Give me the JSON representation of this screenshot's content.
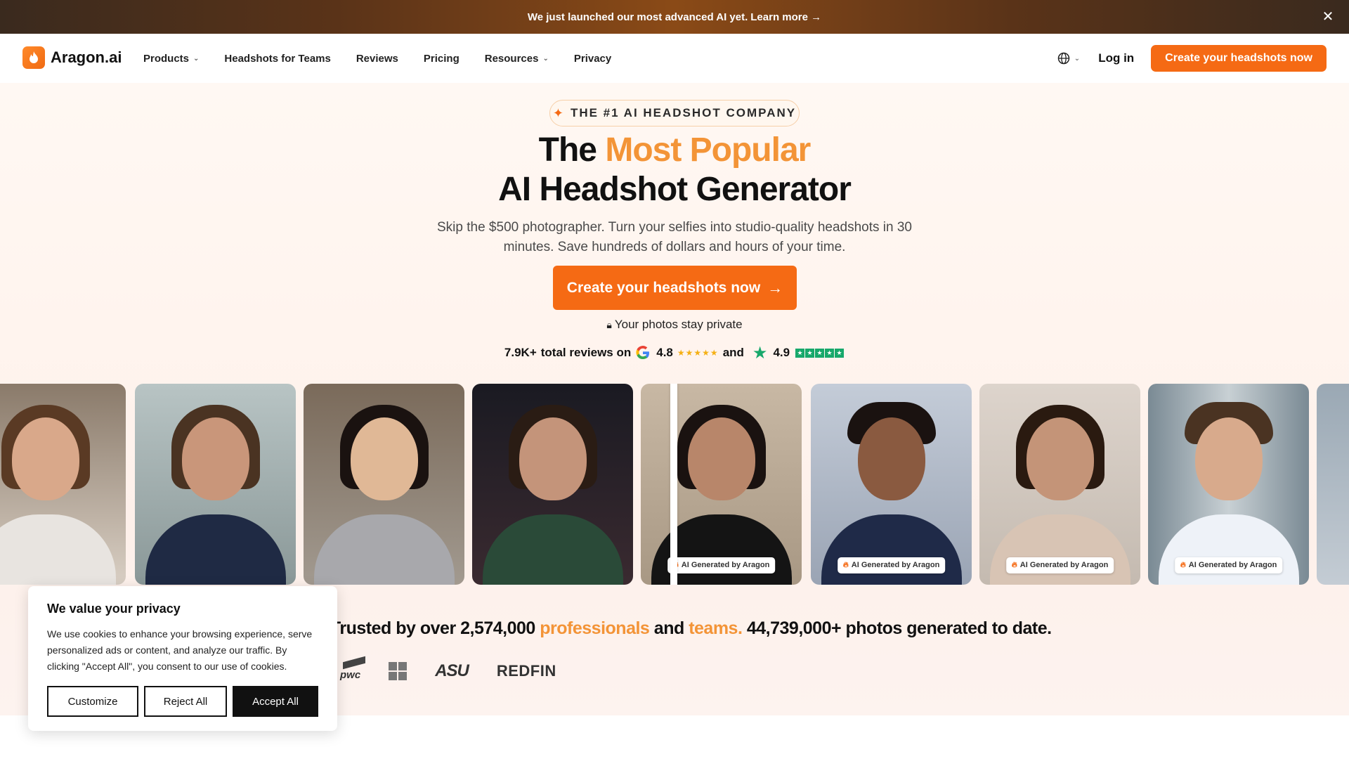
{
  "announcement": {
    "text": "We just launched our most advanced AI yet.",
    "link": "Learn more →"
  },
  "brand": {
    "name": "Aragon.ai",
    "accent_color": "#f56a14"
  },
  "nav": {
    "items": [
      {
        "label": "Products",
        "dropdown": true
      },
      {
        "label": "Headshots for Teams",
        "dropdown": false
      },
      {
        "label": "Reviews",
        "dropdown": false
      },
      {
        "label": "Pricing",
        "dropdown": false
      },
      {
        "label": "Resources",
        "dropdown": true
      },
      {
        "label": "Privacy",
        "dropdown": false
      }
    ],
    "login": "Log in",
    "cta": "Create your headshots now"
  },
  "hero": {
    "badge": "THE #1 AI HEADSHOT COMPANY",
    "title_part1": "The ",
    "title_accent": "Most Popular",
    "title_line2": "AI Headshot Generator",
    "subtitle": "Skip the $500 photographer. Turn your selfies into studio-quality headshots in 30 minutes. Save hundreds of dollars and hours of your time.",
    "cta": "Create your headshots now",
    "private_note": "Your photos stay private",
    "reviews_count": "7.9K+",
    "reviews_text": "total reviews on",
    "google_rating": "4.8",
    "and_text": "and",
    "trustpilot_rating": "4.9"
  },
  "carousel": {
    "ai_label": "AI Generated by Aragon"
  },
  "trusted": {
    "part1": "Trusted by over 2,574,000 ",
    "professionals": "professionals",
    "and": " and ",
    "teams": "teams.",
    "part2": " 44,739,000+ photos generated to date.",
    "logos": [
      "pwc",
      "ASU",
      "REDFIN"
    ]
  },
  "cookie": {
    "title": "We value your privacy",
    "text": "We use cookies to enhance your browsing experience, serve personalized ads or content, and analyze our traffic. By clicking \"Accept All\", you consent to our use of cookies.",
    "customize": "Customize",
    "reject": "Reject All",
    "accept": "Accept All"
  }
}
